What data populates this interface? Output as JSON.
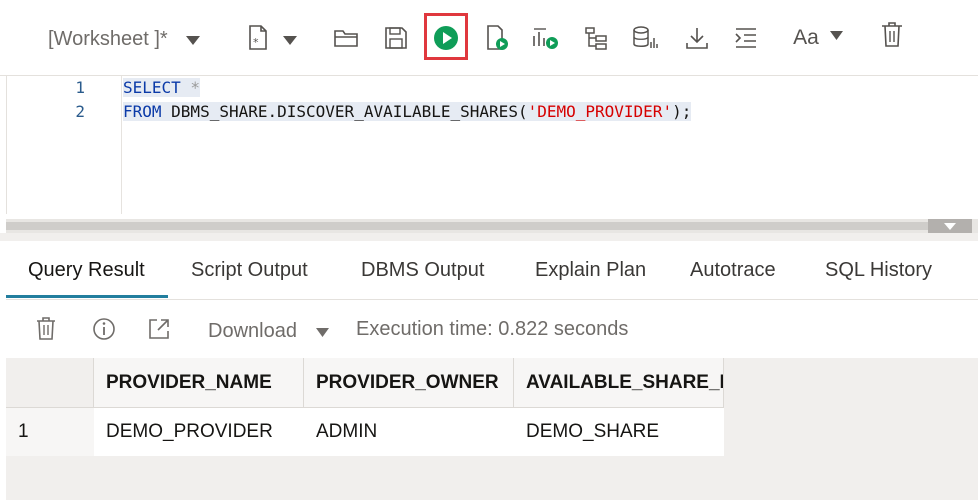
{
  "worksheet": {
    "title": "[Worksheet ]*"
  },
  "toolbar": {
    "buttons": [
      {
        "name": "new-file-icon"
      },
      {
        "name": "open-folder-icon"
      },
      {
        "name": "save-icon"
      },
      {
        "name": "run-statement-icon"
      },
      {
        "name": "run-script-icon"
      },
      {
        "name": "explain-plan-icon"
      },
      {
        "name": "autotrace-icon"
      },
      {
        "name": "sql-statistics-icon"
      },
      {
        "name": "download-icon"
      },
      {
        "name": "format-icon"
      },
      {
        "name": "font-size-icon"
      },
      {
        "name": "clear-icon"
      }
    ],
    "font_label": "Aa",
    "accent_color": "#0f9d58",
    "highlight_color": "#e0383e"
  },
  "editor": {
    "line_numbers": [
      "1",
      "2"
    ],
    "line1": {
      "keyword": "SELECT",
      "rest": " *"
    },
    "line2": {
      "keyword": "FROM",
      "rest": " DBMS_SHARE.DISCOVER_AVAILABLE_SHARES(",
      "string": "'DEMO_PROVIDER'",
      "tail": ");"
    }
  },
  "tabs": [
    "Query Result",
    "Script Output",
    "DBMS Output",
    "Explain Plan",
    "Autotrace",
    "SQL History"
  ],
  "result_toolbar": {
    "download_label": "Download",
    "execution_time": "Execution time: 0.822 seconds"
  },
  "grid": {
    "columns": [
      "PROVIDER_NAME",
      "PROVIDER_OWNER",
      "AVAILABLE_SHARE_I"
    ],
    "rows": [
      {
        "num": "1",
        "cells": [
          "DEMO_PROVIDER",
          "ADMIN",
          "DEMO_SHARE"
        ]
      }
    ]
  }
}
